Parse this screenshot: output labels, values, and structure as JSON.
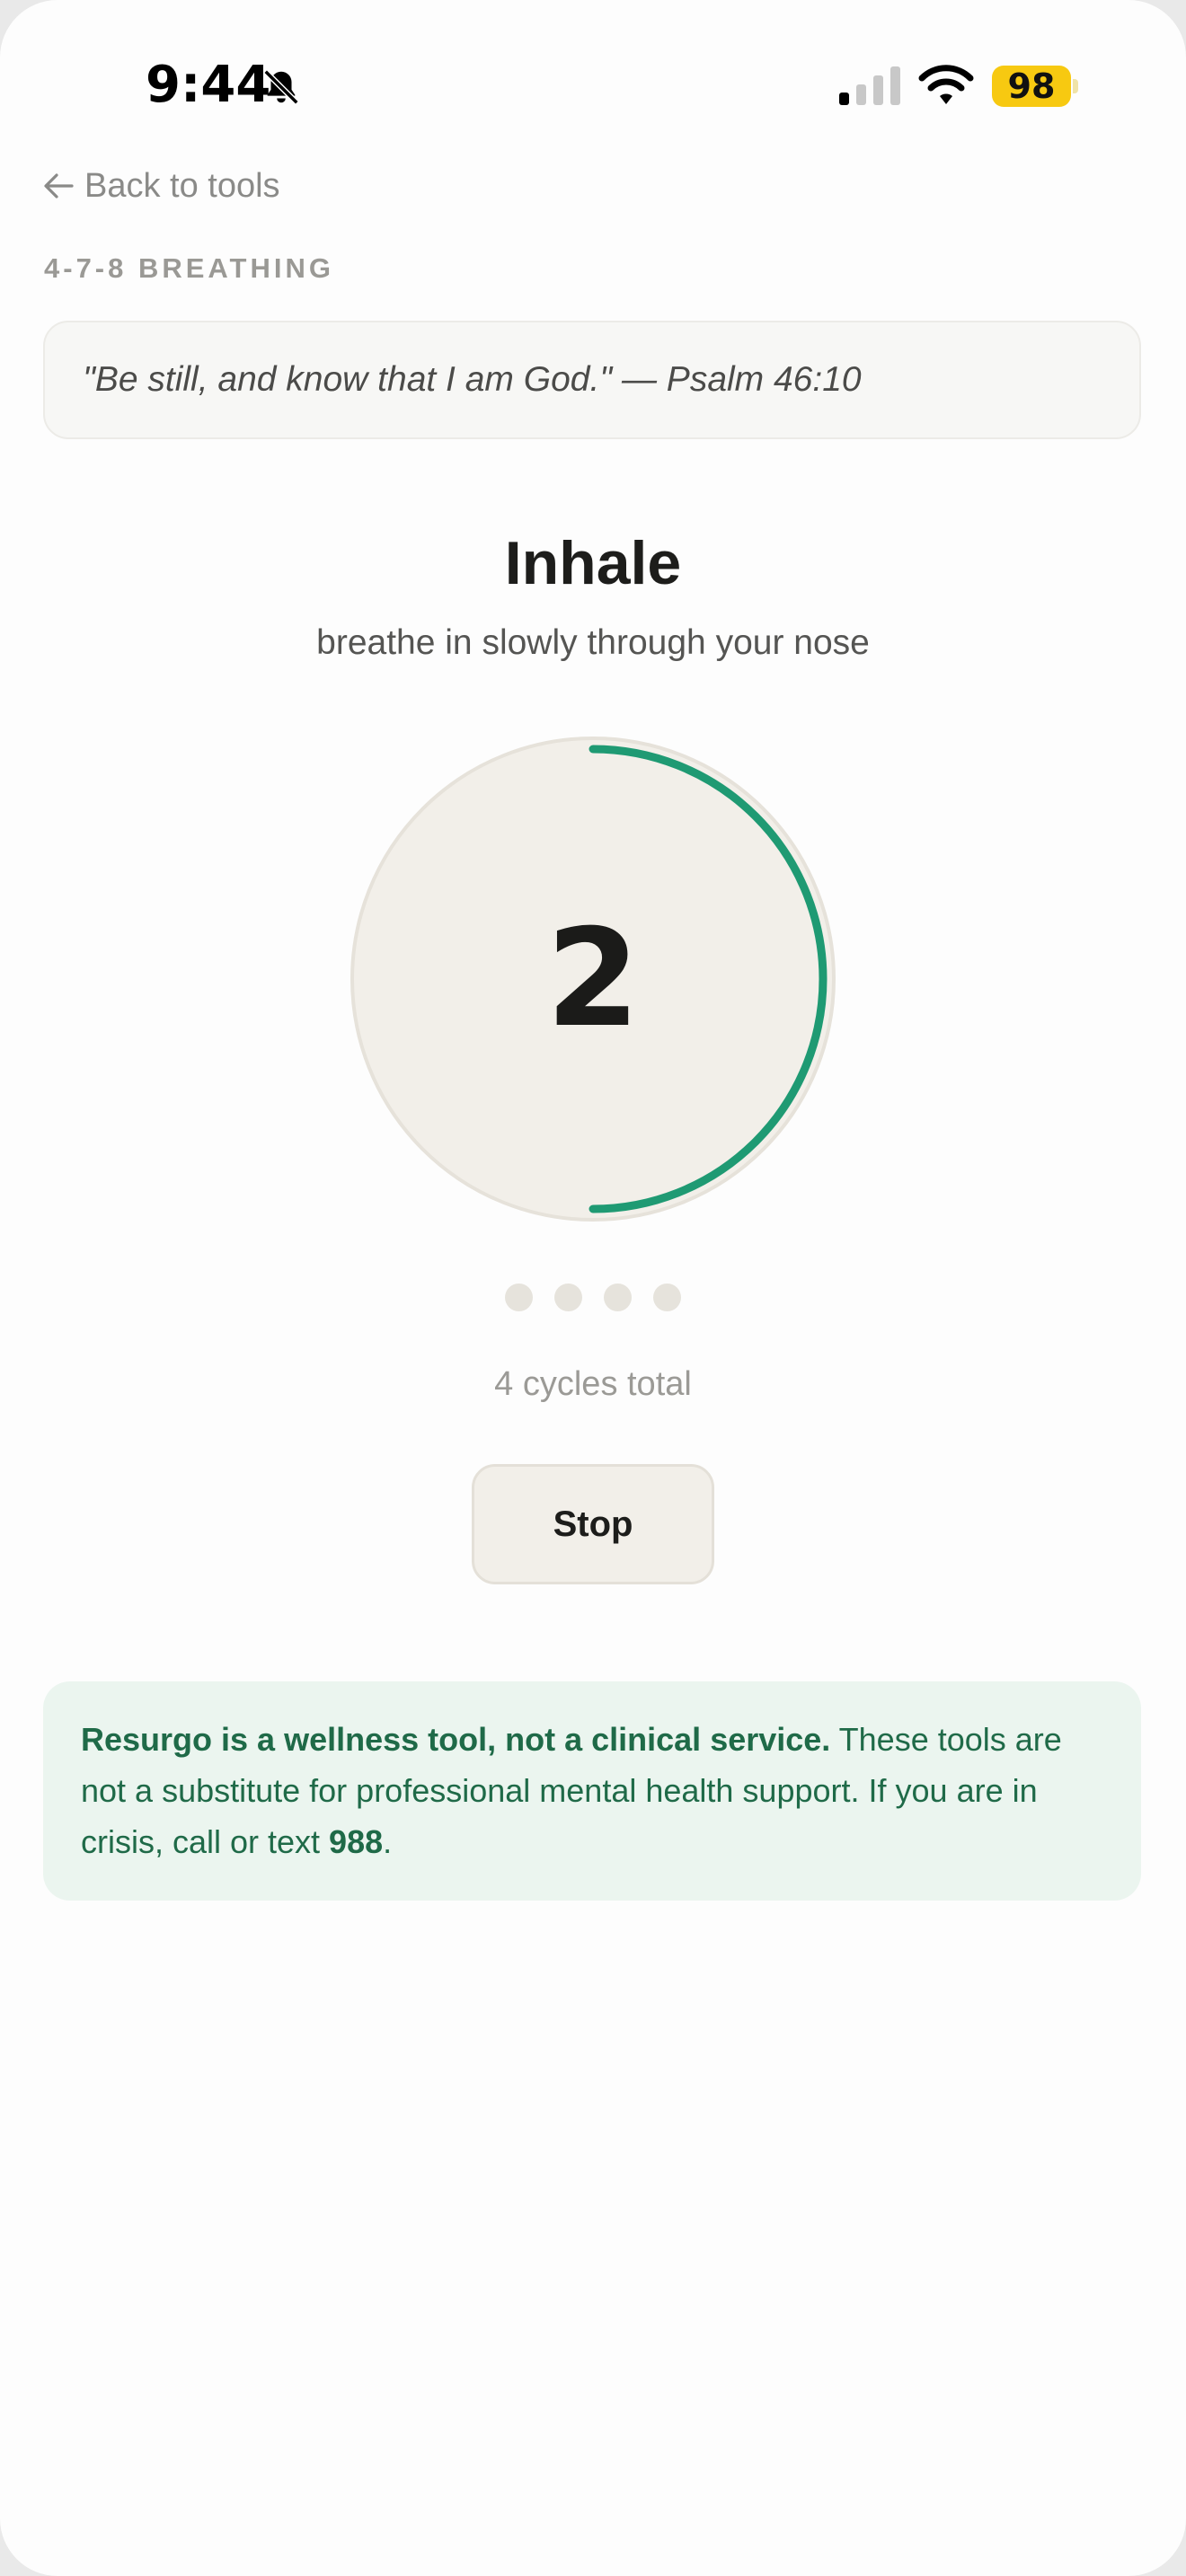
{
  "status_bar": {
    "time": "9:44",
    "battery": "98",
    "icons": [
      "bell-slash-icon",
      "cellular-signal-icon",
      "wifi-icon"
    ]
  },
  "nav": {
    "back_label": "Back to tools",
    "back_icon": "arrow-left-icon"
  },
  "exercise": {
    "label": "4-7-8 BREATHING",
    "verse": "\"Be still, and know that I am God.\" — Psalm 46:10",
    "phase": "Inhale",
    "instruction": "breathe in slowly through your nose",
    "count": "2",
    "phase_progress": 0.5,
    "cycles_completed": 0,
    "cycles_total_count": 4,
    "cycles_text": "4 cycles total",
    "stop_label": "Stop"
  },
  "disclaimer": {
    "bold_lead": "Resurgo is a wellness tool, not a clinical service.",
    "body": " These tools are not a substitute for professional mental health support. If you are in crisis, call or text ",
    "hotline": "988",
    "tail": "."
  },
  "colors": {
    "accent": "#1f9a73",
    "circle_fill": "#f2efe9",
    "disclaimer_bg": "#ebf5ef",
    "disclaimer_text": "#1f6a48",
    "battery": "#f7c911"
  }
}
